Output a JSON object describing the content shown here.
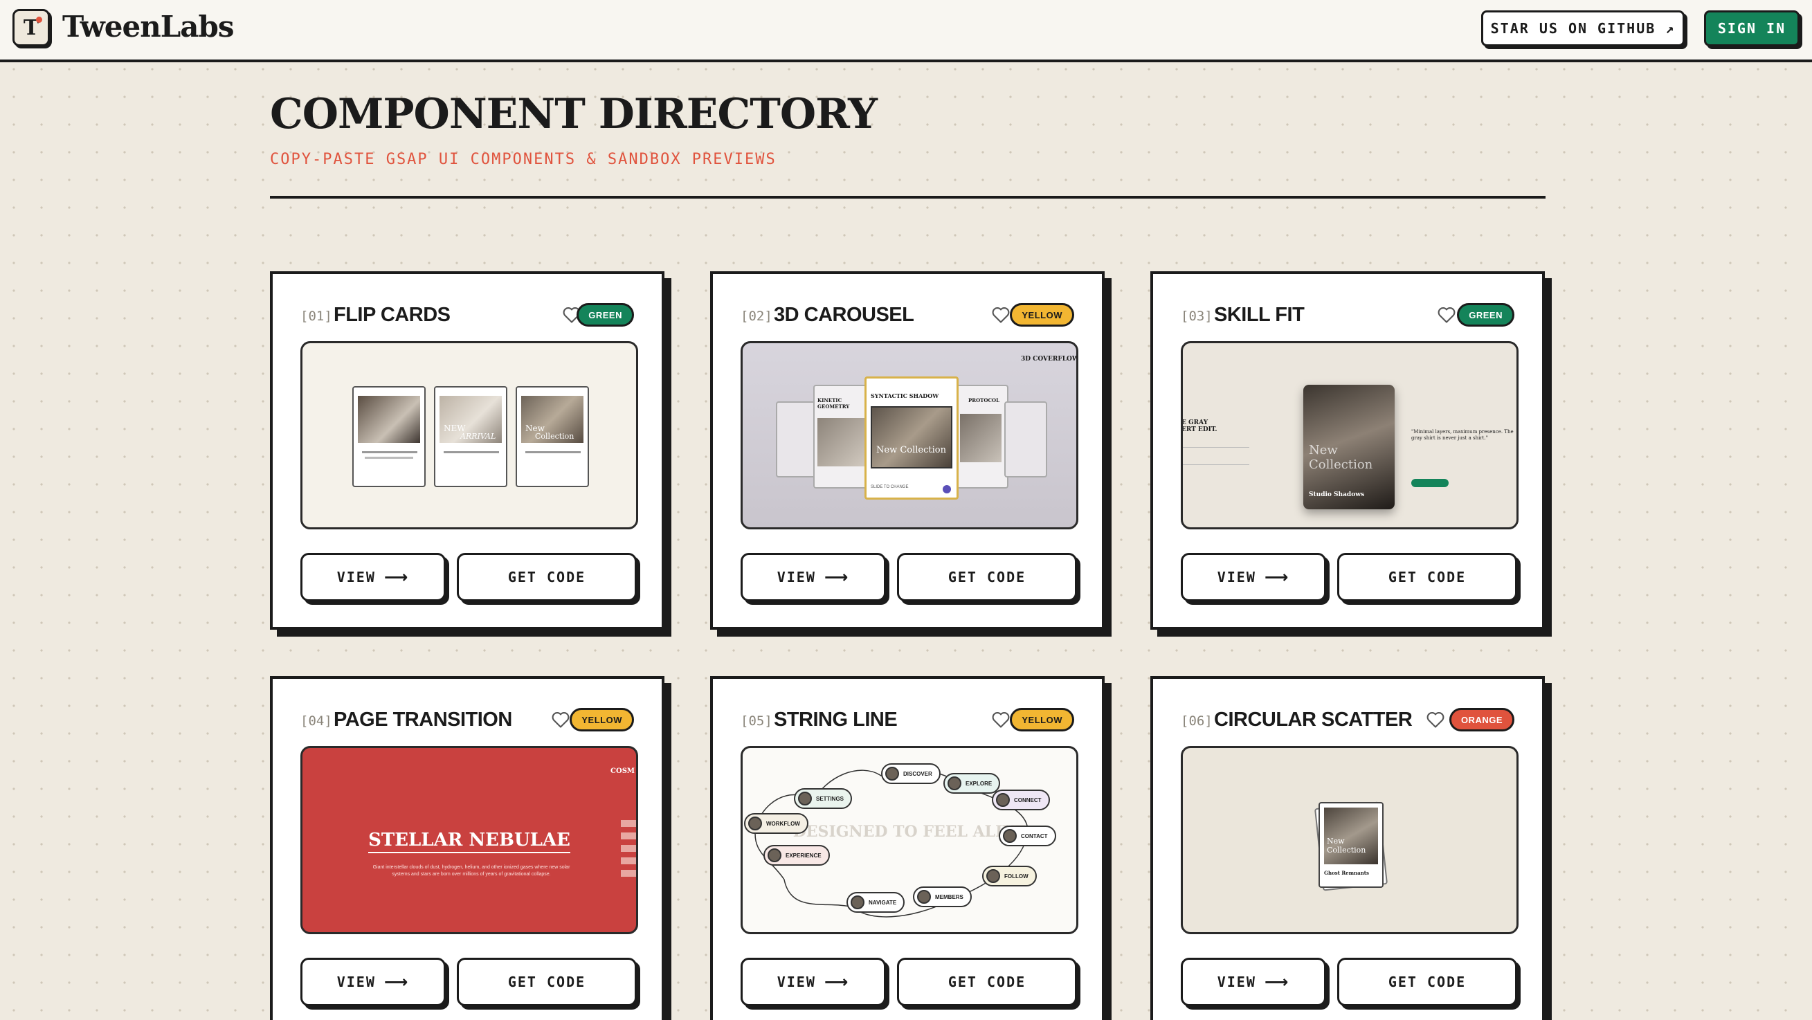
{
  "header": {
    "logo_letter": "T",
    "brand": "TweenLabs",
    "github_label": "STAR US ON GITHUB ↗",
    "signin_label": "SIGN IN"
  },
  "page": {
    "title": "COMPONENT DIRECTORY",
    "subtitle": "COPY-PASTE GSAP UI COMPONENTS & SANDBOX PREVIEWS"
  },
  "colors": {
    "accent_green": "#14845a",
    "accent_yellow": "#f2b632",
    "accent_orange": "#e0533d",
    "ink": "#1b1b1b",
    "background": "#efeae0"
  },
  "cards": [
    {
      "index": "[01]",
      "title": "FLIP CARDS",
      "badge": "GREEN",
      "view_label": "VIEW",
      "code_label": "GET CODE",
      "preview": {
        "labels": [
          "NEW",
          "ARRIVAL",
          "New",
          "Collection"
        ]
      }
    },
    {
      "index": "[02]",
      "title": "3D CAROUSEL",
      "badge": "YELLOW",
      "view_label": "VIEW",
      "code_label": "GET CODE",
      "preview": {
        "corner": "3D COVERFLOW",
        "main_title": "SYNTACTIC SHADOW",
        "left_title": "KINETIC GEOMETRY",
        "right_title": "PROTOCOL",
        "art": "New Collection",
        "slide_label": "SLIDE TO CHANGE"
      }
    },
    {
      "index": "[03]",
      "title": "SKILL FIT",
      "badge": "GREEN",
      "view_label": "VIEW",
      "code_label": "GET CODE",
      "preview": {
        "left_title": "E GRAY\nERT EDIT.",
        "quote": "\"Minimal layers, maximum presence. The gray shirt is never just a shirt.\"",
        "card_title": "Studio Shadows",
        "art": "New Collection"
      }
    },
    {
      "index": "[04]",
      "title": "PAGE TRANSITION",
      "badge": "YELLOW",
      "view_label": "VIEW",
      "code_label": "GET CODE",
      "preview": {
        "headline": "STELLAR NEBULAE",
        "body": "Giant interstellar clouds of dust, hydrogen, helium, and other ionized gases where new solar systems and stars are born over millions of years of gravitational collapse.",
        "corner": "COSM"
      }
    },
    {
      "index": "[05]",
      "title": "STRING LINE",
      "badge": "YELLOW",
      "view_label": "VIEW",
      "code_label": "GET CODE",
      "preview": {
        "watermark": "DESIGNED TO FEEL ALIVE",
        "nodes": [
          "DISCOVER",
          "EXPLORE",
          "CONNECT",
          "CONTACT",
          "FOLLOW",
          "MEMBERS",
          "NAVIGATE",
          "EXPERIENCE",
          "WORKFLOW",
          "SETTINGS"
        ]
      }
    },
    {
      "index": "[06]",
      "title": "CIRCULAR SCATTER",
      "badge": "ORANGE",
      "view_label": "VIEW",
      "code_label": "GET CODE",
      "preview": {
        "card_caption": "Ghost Remnants",
        "art": "New Collection"
      }
    }
  ]
}
